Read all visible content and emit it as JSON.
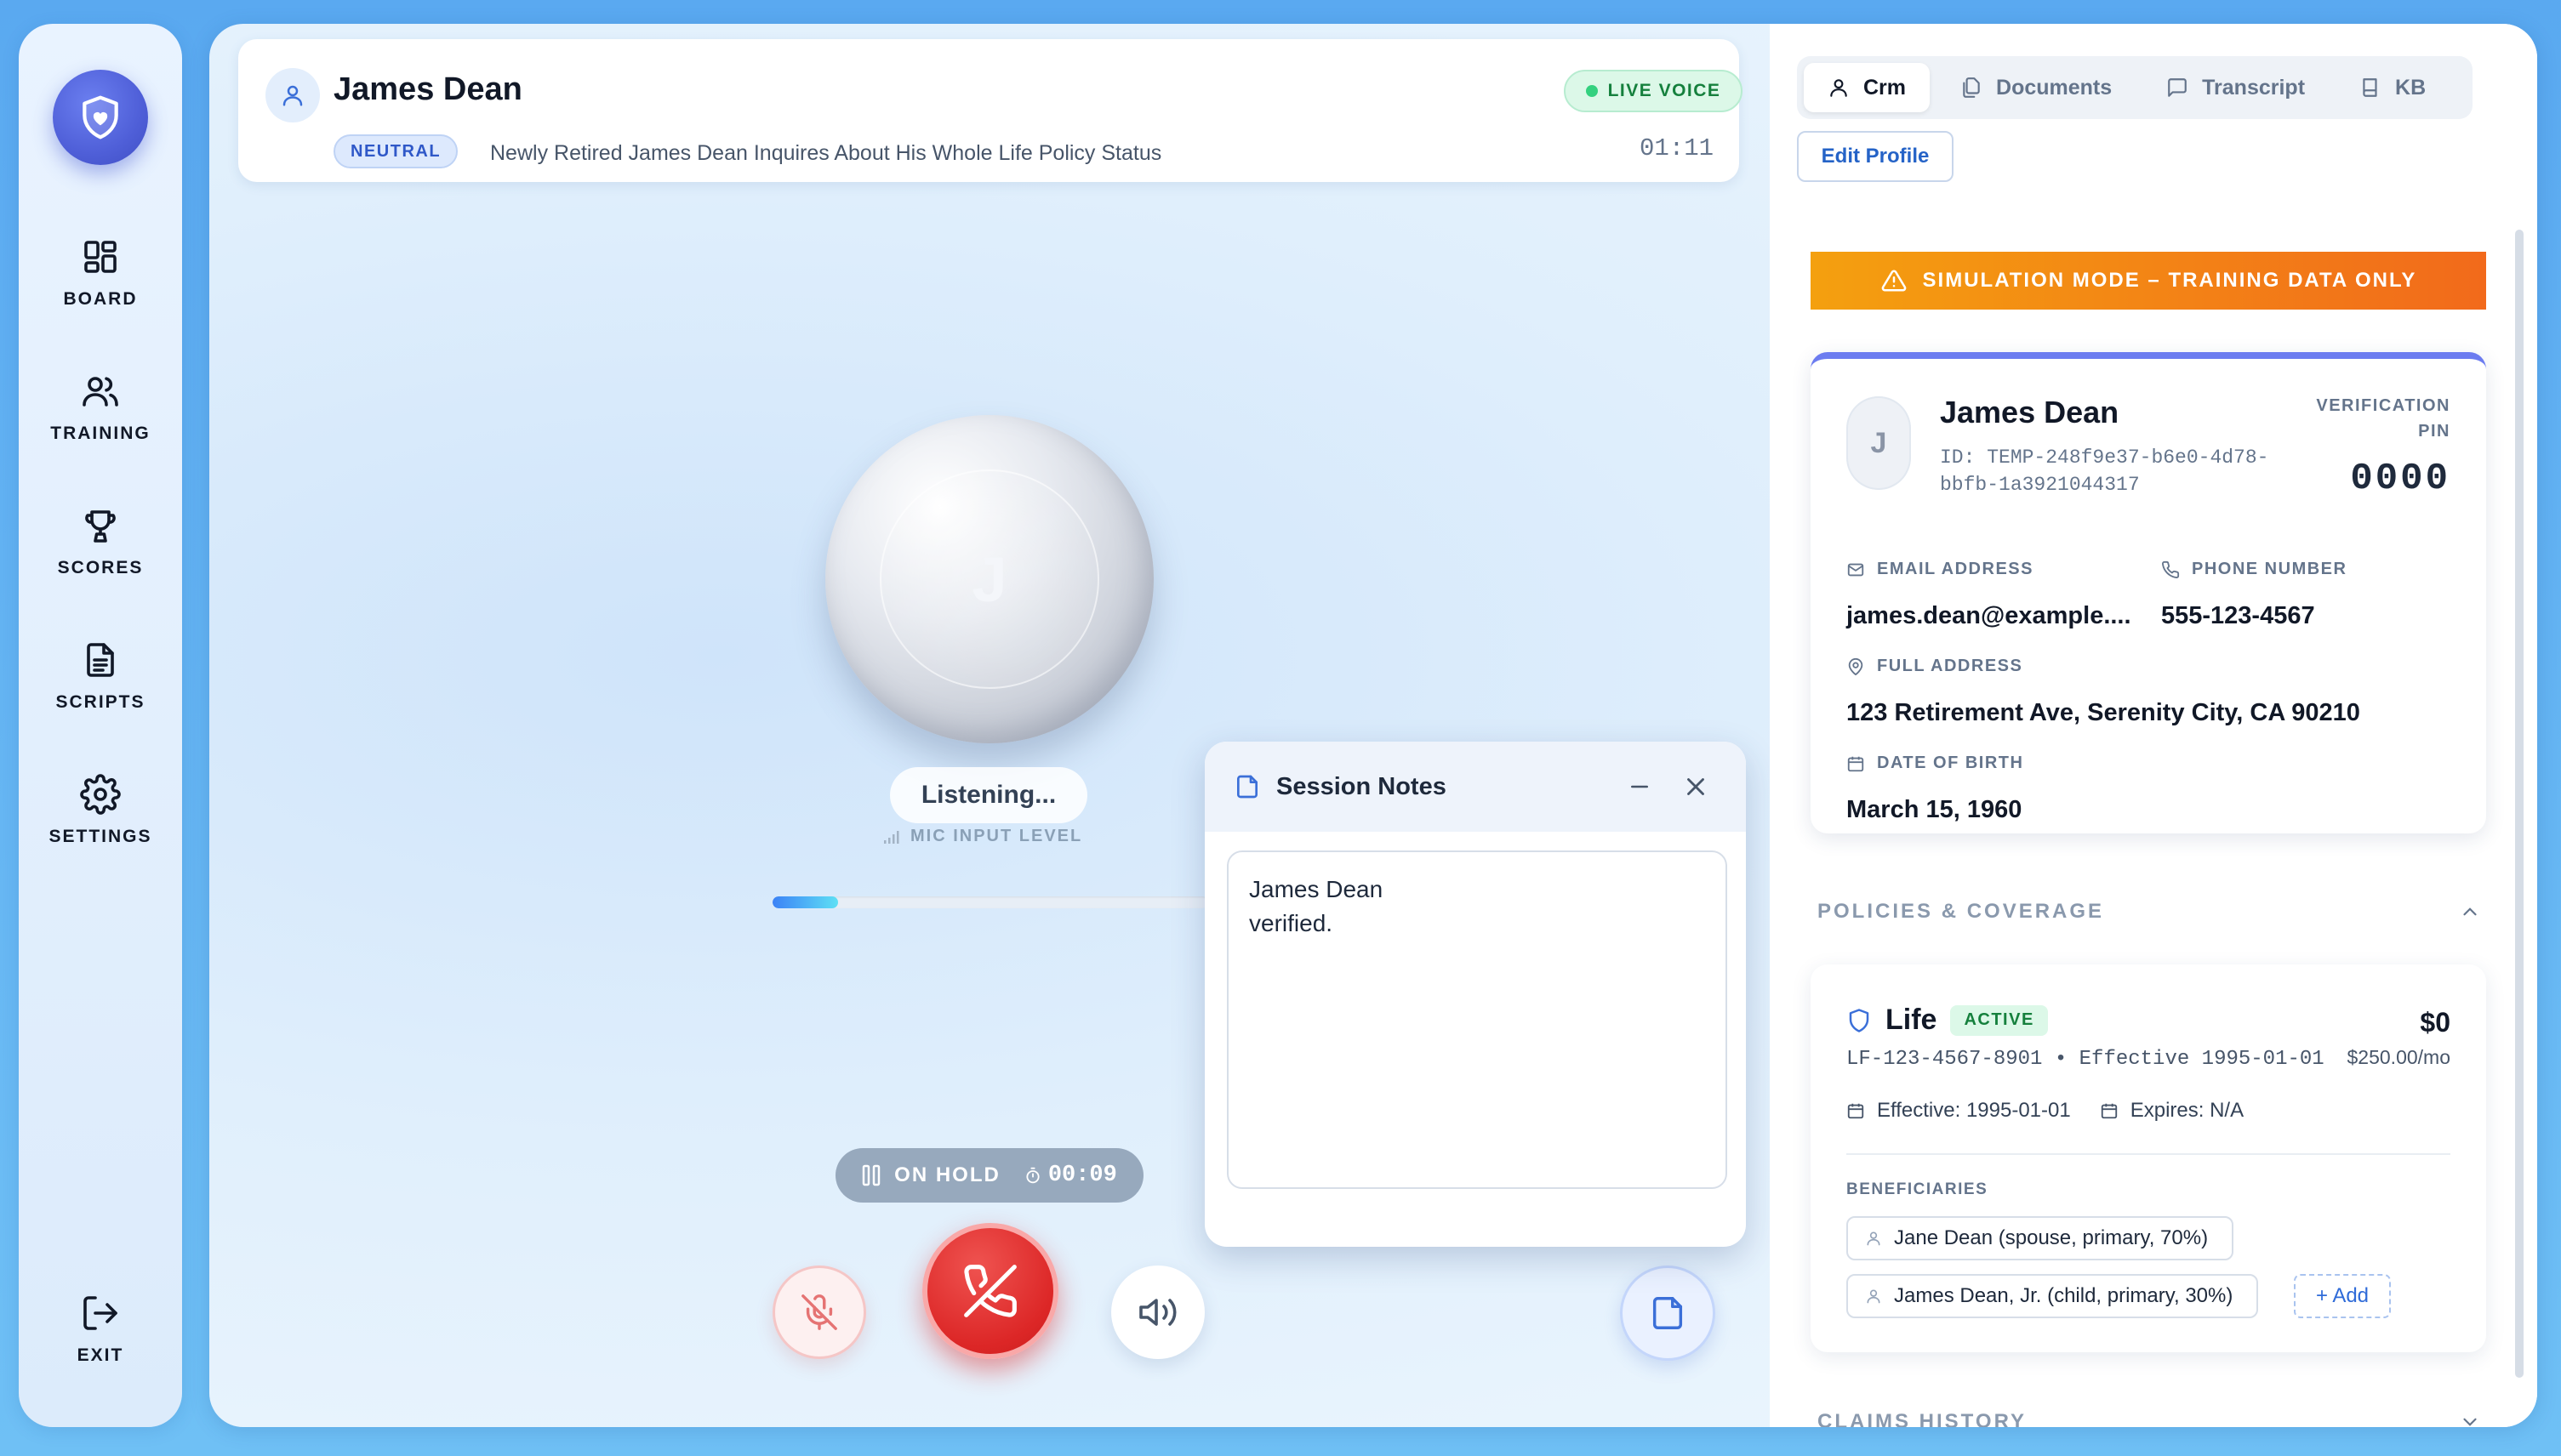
{
  "sidebar": {
    "items": [
      {
        "label": "BOARD",
        "icon": "layout-grid-icon"
      },
      {
        "label": "TRAINING",
        "icon": "users-icon"
      },
      {
        "label": "SCORES",
        "icon": "trophy-icon"
      },
      {
        "label": "SCRIPTS",
        "icon": "file-text-icon"
      },
      {
        "label": "SETTINGS",
        "icon": "gear-icon"
      }
    ],
    "exit_label": "EXIT"
  },
  "call_header": {
    "caller_name": "James Dean",
    "sentiment": "NEUTRAL",
    "subject": "Newly Retired James Dean Inquires About His Whole Life Policy Status",
    "live_label": "LIVE VOICE",
    "call_timer": "01:11"
  },
  "orb": {
    "initial": "J",
    "status": "Listening...",
    "mic_label": "MIC INPUT LEVEL",
    "mic_level": 0.15
  },
  "hold": {
    "label": "ON HOLD",
    "timer": "00:09"
  },
  "session_notes": {
    "title": "Session Notes",
    "text": "James Dean\nverified."
  },
  "right_panel": {
    "tabs": [
      {
        "label": "Crm",
        "active": true
      },
      {
        "label": "Documents",
        "active": false
      },
      {
        "label": "Transcript",
        "active": false
      },
      {
        "label": "KB",
        "active": false
      }
    ],
    "edit_profile": "Edit Profile",
    "simulation_banner": "SIMULATION MODE – TRAINING DATA ONLY",
    "profile": {
      "initial": "J",
      "name": "James Dean",
      "id_text": "ID: TEMP-248f9e37-b6e0-4d78-bbfb-1a3921044317",
      "pin_label": "VERIFICATION PIN",
      "pin": "0000",
      "email_label": "EMAIL ADDRESS",
      "email": "james.dean@example....",
      "phone_label": "PHONE NUMBER",
      "phone": "555-123-4567",
      "address_label": "FULL ADDRESS",
      "address": "123 Retirement Ave, Serenity City, CA 90210",
      "dob_label": "DATE OF BIRTH",
      "dob": "March 15, 1960"
    },
    "policies_heading": "POLICIES & COVERAGE",
    "policy": {
      "type": "Life",
      "status": "ACTIVE",
      "amount": "$0",
      "number_line": "LF-123-4567-8901 • Effective 1995-01-01",
      "premium": "$250.00/mo",
      "effective": "Effective: 1995-01-01",
      "expires": "Expires: N/A",
      "beneficiaries_label": "BENEFICIARIES",
      "beneficiaries": [
        "Jane Dean (spouse, primary, 70%)",
        "James Dean, Jr. (child, primary, 30%)"
      ],
      "add_label": "+ Add"
    },
    "claims_heading": "CLAIMS HISTORY"
  },
  "colors": {
    "accent": "#4f5fd8",
    "hangup": "#dc2626",
    "live": "#15803d",
    "banner_start": "#f4a00f",
    "banner_end": "#f26a1b"
  }
}
